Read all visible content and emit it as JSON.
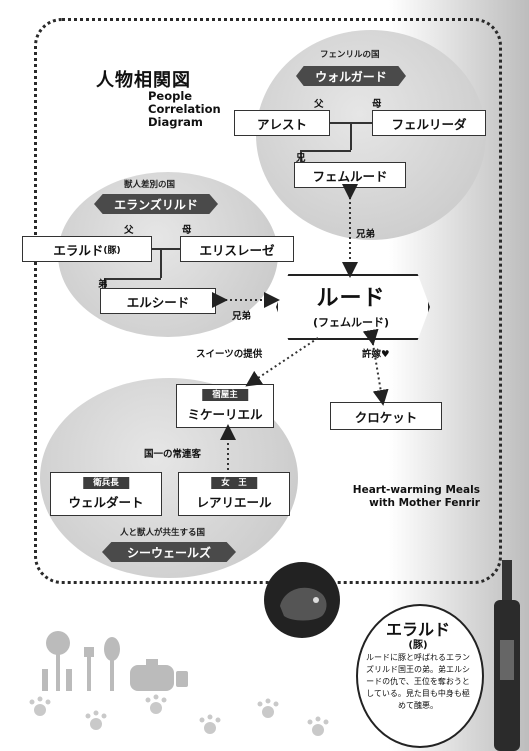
{
  "title": {
    "jp": "人物相関図",
    "en": [
      "People",
      "Correlation",
      "Diagram"
    ]
  },
  "wolgard": {
    "country_label": "フェンリルの国",
    "banner": "ウォルガード",
    "father_label": "父",
    "mother_label": "母",
    "brother_label": "兄",
    "father": "アレスト",
    "mother": "フェルリーダ",
    "brother": "フェムルード"
  },
  "elanz": {
    "country_label": "獣人差別の国",
    "banner": "エランズリルド",
    "father_label": "父",
    "mother_label": "母",
    "younger_label": "弟",
    "father_name": "エラルド",
    "father_tag": "(豚)",
    "mother": "エリスレーゼ",
    "younger": "エルシード"
  },
  "hero": {
    "name": "ルード",
    "sub": "(フェムルード)"
  },
  "relations": {
    "brother_top": "兄弟",
    "brother_left": "兄弟",
    "sweets": "スイーツの提供",
    "fiancee": "許嫁♥",
    "regulars": "国一の常連客"
  },
  "crocket": "クロケット",
  "inn": {
    "tag": "宿屋主",
    "name": "ミケーリエル"
  },
  "guard": {
    "tag": "衛兵長",
    "name": "ウェルダート"
  },
  "queen": {
    "tag": "女　王",
    "name": "レアリエール"
  },
  "seawales": {
    "country_label": "人と獣人が共生する国",
    "banner": "シーウェールズ"
  },
  "brand": [
    "Heart-warming Meals",
    "with Mother Fenrir"
  ],
  "info": {
    "title": "エラルド",
    "sub": "(豚)",
    "text": "ルードに豚と呼ばれるエランズリルド国王の弟。弟エルシードの仇で、王位を奪おうとしている。見た目も中身も極めて醜悪。"
  }
}
